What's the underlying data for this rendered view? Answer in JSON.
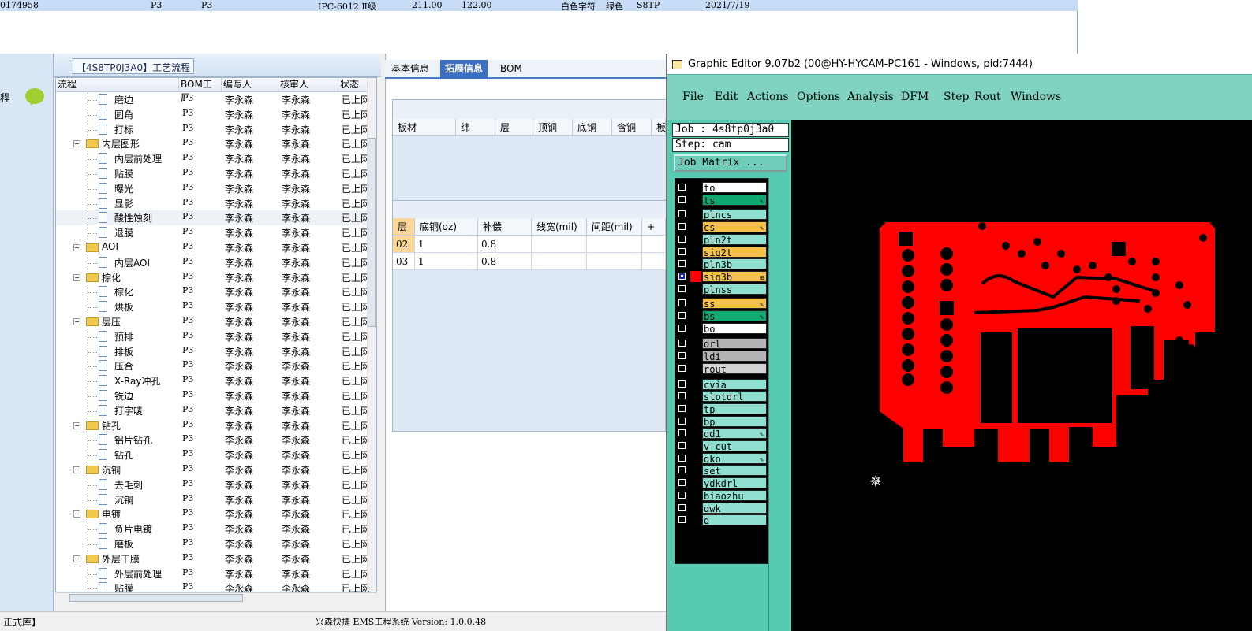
{
  "record_row": {
    "id": "0174958",
    "col2": "P3",
    "col3": "P3",
    "standard": "IPC-6012 Ⅱ级",
    "width": "211.00",
    "height": "122.00",
    "silk": "白色字符",
    "mask": "绿色",
    "code": "S8TP",
    "date": "2021/7/19"
  },
  "left_strip": {
    "label": "程"
  },
  "panel": {
    "title": "【4S8TP0J3A0】工艺流程"
  },
  "grid": {
    "headers": [
      "流程",
      "BOM工厂",
      "编写人",
      "核审人",
      "状态"
    ],
    "rows": [
      {
        "name": "磨边",
        "level": 2,
        "type": "doc",
        "factory": "P3",
        "writer": "李永森",
        "reviewer": "李永森",
        "status": "已上网"
      },
      {
        "name": "圆角",
        "level": 2,
        "type": "doc",
        "factory": "P3",
        "writer": "李永森",
        "reviewer": "李永森",
        "status": "已上网"
      },
      {
        "name": "打标",
        "level": 2,
        "type": "doc",
        "factory": "P3",
        "writer": "李永森",
        "reviewer": "李永森",
        "status": "已上网"
      },
      {
        "name": "内层图形",
        "level": 1,
        "type": "folder",
        "factory": "P3",
        "writer": "李永森",
        "reviewer": "李永森",
        "status": "已上网"
      },
      {
        "name": "内层前处理",
        "level": 2,
        "type": "doc",
        "factory": "P3",
        "writer": "李永森",
        "reviewer": "李永森",
        "status": "已上网"
      },
      {
        "name": "贴膜",
        "level": 2,
        "type": "doc",
        "factory": "P3",
        "writer": "李永森",
        "reviewer": "李永森",
        "status": "已上网"
      },
      {
        "name": "曝光",
        "level": 2,
        "type": "doc",
        "factory": "P3",
        "writer": "李永森",
        "reviewer": "李永森",
        "status": "已上网"
      },
      {
        "name": "显影",
        "level": 2,
        "type": "doc",
        "factory": "P3",
        "writer": "李永森",
        "reviewer": "李永森",
        "status": "已上网"
      },
      {
        "name": "酸性蚀刻",
        "level": 2,
        "type": "doc",
        "factory": "P3",
        "writer": "李永森",
        "reviewer": "李永森",
        "status": "已上网",
        "selected": true
      },
      {
        "name": "退膜",
        "level": 2,
        "type": "doc",
        "factory": "P3",
        "writer": "李永森",
        "reviewer": "李永森",
        "status": "已上网"
      },
      {
        "name": "AOI",
        "level": 1,
        "type": "folder",
        "factory": "P3",
        "writer": "李永森",
        "reviewer": "李永森",
        "status": "已上网"
      },
      {
        "name": "内层AOI",
        "level": 2,
        "type": "doc",
        "factory": "P3",
        "writer": "李永森",
        "reviewer": "李永森",
        "status": "已上网"
      },
      {
        "name": "棕化",
        "level": 1,
        "type": "folder",
        "factory": "P3",
        "writer": "李永森",
        "reviewer": "李永森",
        "status": "已上网"
      },
      {
        "name": "棕化",
        "level": 2,
        "type": "doc",
        "factory": "P3",
        "writer": "李永森",
        "reviewer": "李永森",
        "status": "已上网"
      },
      {
        "name": "烘板",
        "level": 2,
        "type": "doc",
        "factory": "P3",
        "writer": "李永森",
        "reviewer": "李永森",
        "status": "已上网"
      },
      {
        "name": "层压",
        "level": 1,
        "type": "folder",
        "factory": "P3",
        "writer": "李永森",
        "reviewer": "李永森",
        "status": "已上网"
      },
      {
        "name": "预排",
        "level": 2,
        "type": "doc",
        "factory": "P3",
        "writer": "李永森",
        "reviewer": "李永森",
        "status": "已上网"
      },
      {
        "name": "排板",
        "level": 2,
        "type": "doc",
        "factory": "P3",
        "writer": "李永森",
        "reviewer": "李永森",
        "status": "已上网"
      },
      {
        "name": "压合",
        "level": 2,
        "type": "doc",
        "factory": "P3",
        "writer": "李永森",
        "reviewer": "李永森",
        "status": "已上网"
      },
      {
        "name": "X-Ray冲孔",
        "level": 2,
        "type": "doc",
        "factory": "P3",
        "writer": "李永森",
        "reviewer": "李永森",
        "status": "已上网"
      },
      {
        "name": "铣边",
        "level": 2,
        "type": "doc",
        "factory": "P3",
        "writer": "李永森",
        "reviewer": "李永森",
        "status": "已上网"
      },
      {
        "name": "打字唛",
        "level": 2,
        "type": "doc",
        "factory": "P3",
        "writer": "李永森",
        "reviewer": "李永森",
        "status": "已上网"
      },
      {
        "name": "钻孔",
        "level": 1,
        "type": "folder",
        "factory": "P3",
        "writer": "李永森",
        "reviewer": "李永森",
        "status": "已上网"
      },
      {
        "name": "铝片钻孔",
        "level": 2,
        "type": "doc",
        "factory": "P3",
        "writer": "李永森",
        "reviewer": "李永森",
        "status": "已上网"
      },
      {
        "name": "钻孔",
        "level": 2,
        "type": "doc",
        "factory": "P3",
        "writer": "李永森",
        "reviewer": "李永森",
        "status": "已上网"
      },
      {
        "name": "沉铜",
        "level": 1,
        "type": "folder",
        "factory": "P3",
        "writer": "李永森",
        "reviewer": "李永森",
        "status": "已上网"
      },
      {
        "name": "去毛刺",
        "level": 2,
        "type": "doc",
        "factory": "P3",
        "writer": "李永森",
        "reviewer": "李永森",
        "status": "已上网"
      },
      {
        "name": "沉铜",
        "level": 2,
        "type": "doc",
        "factory": "P3",
        "writer": "李永森",
        "reviewer": "李永森",
        "status": "已上网"
      },
      {
        "name": "电镀",
        "level": 1,
        "type": "folder",
        "factory": "P3",
        "writer": "李永森",
        "reviewer": "李永森",
        "status": "已上网"
      },
      {
        "name": "负片电镀",
        "level": 2,
        "type": "doc",
        "factory": "P3",
        "writer": "李永森",
        "reviewer": "李永森",
        "status": "已上网"
      },
      {
        "name": "磨板",
        "level": 2,
        "type": "doc",
        "factory": "P3",
        "writer": "李永森",
        "reviewer": "李永森",
        "status": "已上网"
      },
      {
        "name": "外层干膜",
        "level": 1,
        "type": "folder",
        "factory": "P3",
        "writer": "李永森",
        "reviewer": "李永森",
        "status": "已上网"
      },
      {
        "name": "外层前处理",
        "level": 2,
        "type": "doc",
        "factory": "P3",
        "writer": "李永森",
        "reviewer": "李永森",
        "status": "已上网"
      },
      {
        "name": "贴膜",
        "level": 2,
        "type": "doc",
        "factory": "P3",
        "writer": "李永森",
        "reviewer": "李永森",
        "status": "已上网"
      }
    ]
  },
  "mid": {
    "tabs": [
      "基本信息",
      "拓展信息",
      "BOM"
    ],
    "active_tab": 1,
    "board_headers": [
      "板材",
      "纬",
      "层",
      "顶铜",
      "底铜",
      "含铜",
      "板"
    ],
    "layer_headers": [
      "层",
      "底铜(oz)",
      "补偿",
      "线宽(mil)",
      "间距(mil)",
      "+"
    ],
    "layer_rows": [
      {
        "layer": "02",
        "copper": "1",
        "comp": "0.8"
      },
      {
        "layer": "03",
        "copper": "1",
        "comp": "0.8"
      }
    ]
  },
  "status_bar": {
    "left": "正式库】",
    "center": "兴森快捷  EMS工程系统  Version: 1.0.0.48"
  },
  "editor": {
    "title": "Graphic Editor 9.07b2 (00@HY-HYCAM-PC161 - Windows, pid:7444)",
    "menu": [
      "File",
      "Edit",
      "Actions",
      "Options",
      "Analysis",
      "DFM",
      "Step",
      "Rout",
      "Windows"
    ],
    "job": "Job : 4s8tp0j3a0",
    "step": "Step: cam",
    "job_matrix": "Job Matrix ...",
    "layers": [
      {
        "name": "to",
        "color": "#ffffff",
        "mark": ""
      },
      {
        "name": "ts",
        "color": "#10a870",
        "mark": "✎"
      },
      {
        "name": "plncs",
        "color": "#8fe0d0",
        "mark": ""
      },
      {
        "name": "cs",
        "color": "#f5c04a",
        "mark": "✎"
      },
      {
        "name": "pln2t",
        "color": "#8fe0d0",
        "mark": ""
      },
      {
        "name": "sig2t",
        "color": "#f5c04a",
        "mark": ""
      },
      {
        "name": "pln3b",
        "color": "#8fe0d0",
        "mark": ""
      },
      {
        "name": "sig3b",
        "color": "#f5c04a",
        "mark": "⊞",
        "active": true
      },
      {
        "name": "plnss",
        "color": "#8fe0d0",
        "mark": ""
      },
      {
        "name": "ss",
        "color": "#f5c04a",
        "mark": "✎"
      },
      {
        "name": "bs",
        "color": "#10a870",
        "mark": "✎"
      },
      {
        "name": "bo",
        "color": "#ffffff",
        "mark": ""
      },
      {
        "name": "drl",
        "color": "#b4b4b4",
        "mark": ""
      },
      {
        "name": "ldi",
        "color": "#b4b4b4",
        "mark": ""
      },
      {
        "name": "rout",
        "color": "#d2d2d2",
        "mark": ""
      },
      {
        "name": "cvia",
        "color": "#8fe0d0",
        "mark": ""
      },
      {
        "name": "slotdrl",
        "color": "#8fe0d0",
        "mark": ""
      },
      {
        "name": "tp",
        "color": "#8fe0d0",
        "mark": ""
      },
      {
        "name": "bp",
        "color": "#8fe0d0",
        "mark": ""
      },
      {
        "name": "gd1",
        "color": "#8fe0d0",
        "mark": "✎"
      },
      {
        "name": "v-cut",
        "color": "#8fe0d0",
        "mark": ""
      },
      {
        "name": "gko",
        "color": "#8fe0d0",
        "mark": "✎"
      },
      {
        "name": "set",
        "color": "#8fe0d0",
        "mark": ""
      },
      {
        "name": "ydkdrl",
        "color": "#8fe0d0",
        "mark": ""
      },
      {
        "name": "biaozhu",
        "color": "#8fe0d0",
        "mark": ""
      },
      {
        "name": "dwk",
        "color": "#8fe0d0",
        "mark": ""
      },
      {
        "name": "d",
        "color": "#8fe0d0",
        "mark": ""
      }
    ],
    "artwork_color": "#ff0000"
  }
}
